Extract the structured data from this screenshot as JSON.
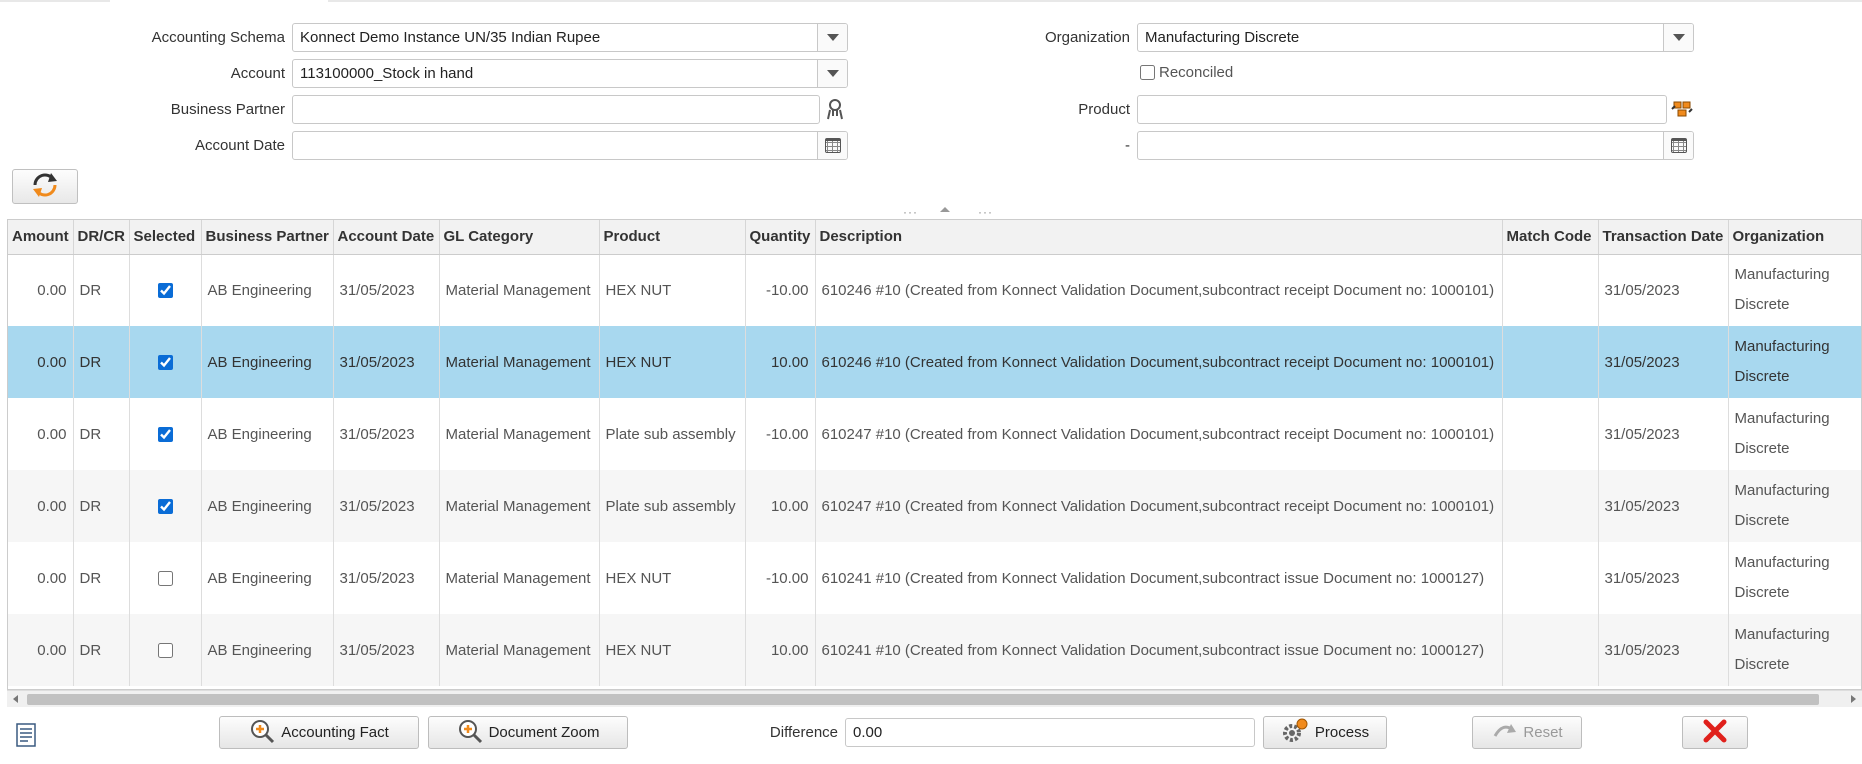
{
  "filters": {
    "accounting_schema": {
      "label": "Accounting Schema",
      "value": "Konnect Demo Instance UN/35 Indian Rupee"
    },
    "account": {
      "label": "Account",
      "value": "113100000_Stock in hand"
    },
    "business_partner": {
      "label": "Business Partner",
      "value": ""
    },
    "account_date": {
      "label": "Account Date",
      "value": ""
    },
    "organization": {
      "label": "Organization",
      "value": "Manufacturing Discrete"
    },
    "reconciled": {
      "label": "Reconciled",
      "checked": false
    },
    "product": {
      "label": "Product",
      "value": ""
    },
    "date_to": {
      "label": "-",
      "value": ""
    }
  },
  "grid": {
    "columns": [
      "Amount",
      "DR/CR",
      "Selected",
      "Business Partner",
      "Account Date",
      "GL Category",
      "Product",
      "Quantity",
      "Description",
      "Match Code",
      "Transaction Date",
      "Organization"
    ],
    "rows": [
      {
        "amount": "0.00",
        "drcr": "DR",
        "selected": true,
        "bp": "AB Engineering",
        "acct_date": "31/05/2023",
        "gl": "Material Management",
        "product": "HEX NUT",
        "qty": "-10.00",
        "desc": "610246 #10 (Created from Konnect Validation Document,subcontract receipt Document no: 1000101)",
        "match": "",
        "trx_date": "31/05/2023",
        "org": "Manufacturing Discrete"
      },
      {
        "amount": "0.00",
        "drcr": "DR",
        "selected": true,
        "bp": "AB Engineering",
        "acct_date": "31/05/2023",
        "gl": "Material Management",
        "product": "HEX NUT",
        "qty": "10.00",
        "desc": "610246 #10 (Created from Konnect Validation Document,subcontract receipt Document no: 1000101)",
        "match": "",
        "trx_date": "31/05/2023",
        "org": "Manufacturing Discrete"
      },
      {
        "amount": "0.00",
        "drcr": "DR",
        "selected": true,
        "bp": "AB Engineering",
        "acct_date": "31/05/2023",
        "gl": "Material Management",
        "product": "Plate sub assembly",
        "qty": "-10.00",
        "desc": "610247 #10 (Created from Konnect Validation Document,subcontract receipt Document no: 1000101)",
        "match": "",
        "trx_date": "31/05/2023",
        "org": "Manufacturing Discrete"
      },
      {
        "amount": "0.00",
        "drcr": "DR",
        "selected": true,
        "bp": "AB Engineering",
        "acct_date": "31/05/2023",
        "gl": "Material Management",
        "product": "Plate sub assembly",
        "qty": "10.00",
        "desc": "610247 #10 (Created from Konnect Validation Document,subcontract receipt Document no: 1000101)",
        "match": "",
        "trx_date": "31/05/2023",
        "org": "Manufacturing Discrete"
      },
      {
        "amount": "0.00",
        "drcr": "DR",
        "selected": false,
        "bp": "AB Engineering",
        "acct_date": "31/05/2023",
        "gl": "Material Management",
        "product": "HEX NUT",
        "qty": "-10.00",
        "desc": "610241 #10 (Created from Konnect Validation Document,subcontract issue Document no: 1000127)",
        "match": "",
        "trx_date": "31/05/2023",
        "org": "Manufacturing Discrete"
      },
      {
        "amount": "0.00",
        "drcr": "DR",
        "selected": false,
        "bp": "AB Engineering",
        "acct_date": "31/05/2023",
        "gl": "Material Management",
        "product": "HEX NUT",
        "qty": "10.00",
        "desc": "610241 #10 (Created from Konnect Validation Document,subcontract issue Document no: 1000127)",
        "match": "",
        "trx_date": "31/05/2023",
        "org": "Manufacturing Discrete"
      }
    ],
    "highlighted_row": 1
  },
  "footer": {
    "accounting_fact_label": "Accounting Fact",
    "document_zoom_label": "Document Zoom",
    "difference_label": "Difference",
    "difference_value": "0.00",
    "process_label": "Process",
    "reset_label": "Reset"
  },
  "colors": {
    "highlight_row": "#a8d8ef",
    "cancel_red": "#e0201b",
    "accent_orange": "#f08a1c"
  }
}
